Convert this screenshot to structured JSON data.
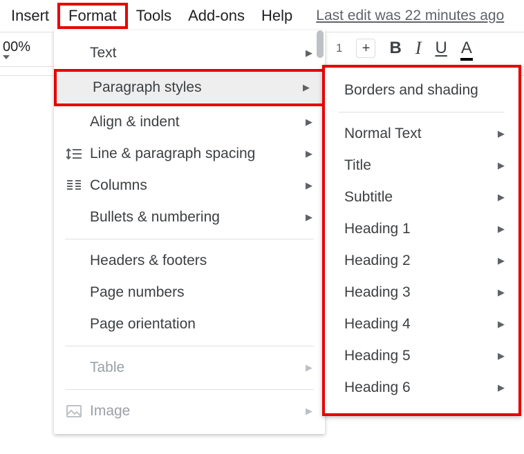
{
  "menubar": {
    "insert": "Insert",
    "format": "Format",
    "tools": "Tools",
    "addons": "Add-ons",
    "help": "Help",
    "last_edit": "Last edit was 22 minutes ago"
  },
  "toolbar": {
    "zoom": "00%",
    "font_size_inc": "+",
    "bold": "B",
    "italic": "I",
    "underline": "U",
    "text_color": "A"
  },
  "format_menu": {
    "text": "Text",
    "paragraph_styles": "Paragraph styles",
    "align_indent": "Align & indent",
    "line_spacing": "Line & paragraph spacing",
    "columns": "Columns",
    "bullets_numbering": "Bullets & numbering",
    "headers_footers": "Headers & footers",
    "page_numbers": "Page numbers",
    "page_orientation": "Page orientation",
    "table": "Table",
    "image": "Image"
  },
  "paragraph_styles_submenu": {
    "borders_shading": "Borders and shading",
    "normal_text": "Normal Text",
    "title": "Title",
    "subtitle": "Subtitle",
    "heading1": "Heading 1",
    "heading2": "Heading 2",
    "heading3": "Heading 3",
    "heading4": "Heading 4",
    "heading5": "Heading 5",
    "heading6": "Heading 6"
  },
  "annotations": {
    "highlight_color": "#e60000"
  }
}
